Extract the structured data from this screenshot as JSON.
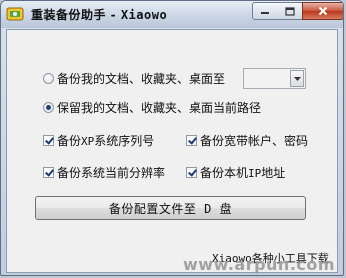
{
  "window": {
    "title": "重装备份助手 - ",
    "app_name": "Xiaowo",
    "icon": "app-icon"
  },
  "caption_buttons": {
    "minimize_icon": "minimize-icon",
    "maximize_icon": "maximize-icon",
    "close_icon": "close-icon"
  },
  "options": {
    "radio_custom": {
      "label": "备份我的文档、收藏夹、桌面至",
      "selected": false
    },
    "radio_keep": {
      "label": "保留我的文档、收藏夹、桌面当前路径",
      "selected": true
    },
    "location_select": {
      "value": ""
    }
  },
  "checkboxes": {
    "xp_serial": {
      "prefix": "备份",
      "latin": "XP",
      "suffix": "系统序列号",
      "checked": true
    },
    "broadband": {
      "prefix": "备份宽带帐户、密码",
      "latin": "",
      "suffix": "",
      "checked": true
    },
    "resolution": {
      "prefix": "备份系统当前分辨率",
      "latin": "",
      "suffix": "",
      "checked": true
    },
    "ip_address": {
      "prefix": "备份本机",
      "latin": "IP",
      "suffix": "地址",
      "checked": true
    }
  },
  "action": {
    "backup_button_prefix": "备份配置文件至",
    "backup_button_drive": " D ",
    "backup_button_suffix": "盘"
  },
  "footer": {
    "text": "Xiaowo各种小工具下载"
  },
  "watermark": {
    "text": "www.arpun.com"
  },
  "colors": {
    "accent": "#1f3f78",
    "close_button": "#c8553b"
  }
}
